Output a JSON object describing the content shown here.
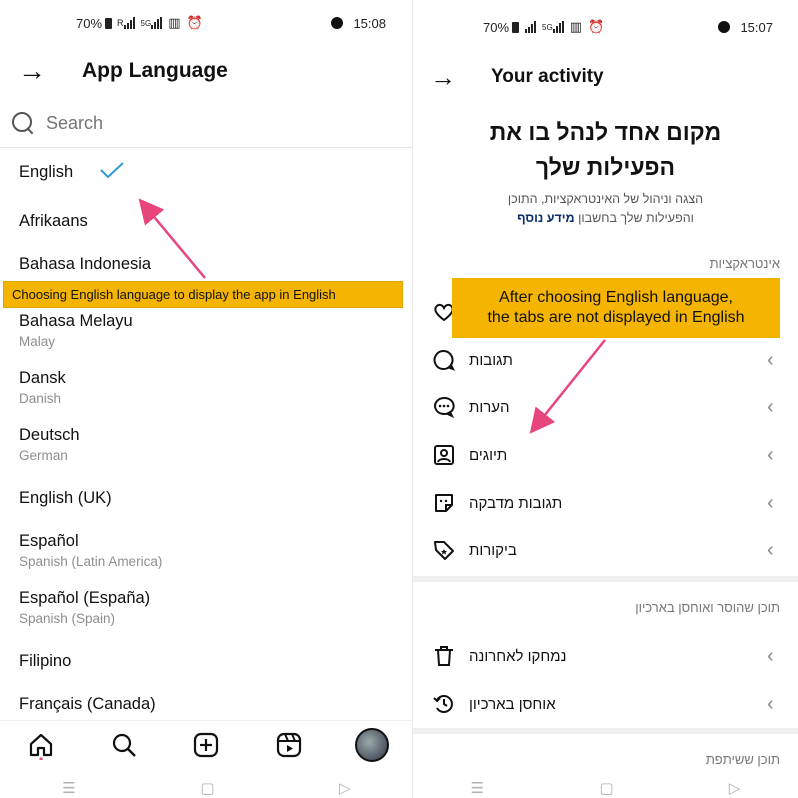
{
  "left": {
    "status": {
      "battery": "70%",
      "network": "R",
      "net2": "5G",
      "time": "15:08"
    },
    "header": {
      "back_icon": "arrow-right-icon",
      "title": "App Language"
    },
    "search": {
      "placeholder": "Search"
    },
    "languages": [
      {
        "name": "English",
        "sub": "",
        "selected": true
      },
      {
        "name": "Afrikaans",
        "sub": ""
      },
      {
        "name": "Bahasa Indonesia",
        "sub": ""
      },
      {
        "name": "Bahasa Melayu",
        "sub": "Malay"
      },
      {
        "name": "Dansk",
        "sub": "Danish"
      },
      {
        "name": "Deutsch",
        "sub": "German"
      },
      {
        "name": "English (UK)",
        "sub": ""
      },
      {
        "name": "Español",
        "sub": "Spanish (Latin America)"
      },
      {
        "name": "Español (España)",
        "sub": "Spanish (Spain)"
      },
      {
        "name": "Filipino",
        "sub": ""
      },
      {
        "name": "Français (Canada)",
        "sub": ""
      }
    ],
    "annotation": "Choosing English language to display the app in English",
    "nav": [
      "home-icon",
      "search-icon",
      "add-post-icon",
      "reels-icon",
      "profile-avatar"
    ],
    "sysnav": [
      "☰",
      "▢",
      "▷"
    ]
  },
  "right": {
    "status": {
      "battery": "70%",
      "net2": "5G",
      "time": "15:07"
    },
    "header": {
      "back_icon": "arrow-right-icon",
      "title": "Your activity"
    },
    "hero": {
      "title_line1": "מקום אחד לנהל בו את",
      "title_line2": "הפעילות שלך",
      "sub_line1": "הצגה וניהול של האינטראקציות, התוכן",
      "sub_line2_pre": "והפעילות שלך בחשבון",
      "sub_line2_link": "מידע נוסף"
    },
    "sections": {
      "interactions": "אינטראקציות",
      "removed": "תוכן שהוסר ואוחסן בארכיון",
      "shared": "תוכן ששיתפת"
    },
    "rows": [
      {
        "label": "תגובות",
        "icon": "comment-bubble-icon"
      },
      {
        "label": "הערות",
        "icon": "chat-dots-icon"
      },
      {
        "label": "תיוגים",
        "icon": "tag-person-icon"
      },
      {
        "label": "תגובות מדבקה",
        "icon": "sticker-icon"
      },
      {
        "label": "ביקורות",
        "icon": "review-tag-icon"
      },
      {
        "label": "נמחקו לאחרונה",
        "icon": "trash-icon"
      },
      {
        "label": "אוחסן בארכיון",
        "icon": "archive-clock-icon"
      }
    ],
    "annotation_line1": "After choosing English language,",
    "annotation_line2": "the tabs are not displayed in English",
    "sysnav": [
      "☰",
      "▢",
      "▷"
    ]
  },
  "colors": {
    "annotation_bg": "#f4b400",
    "arrow": "#e8457a",
    "check": "#2e9ad8"
  }
}
